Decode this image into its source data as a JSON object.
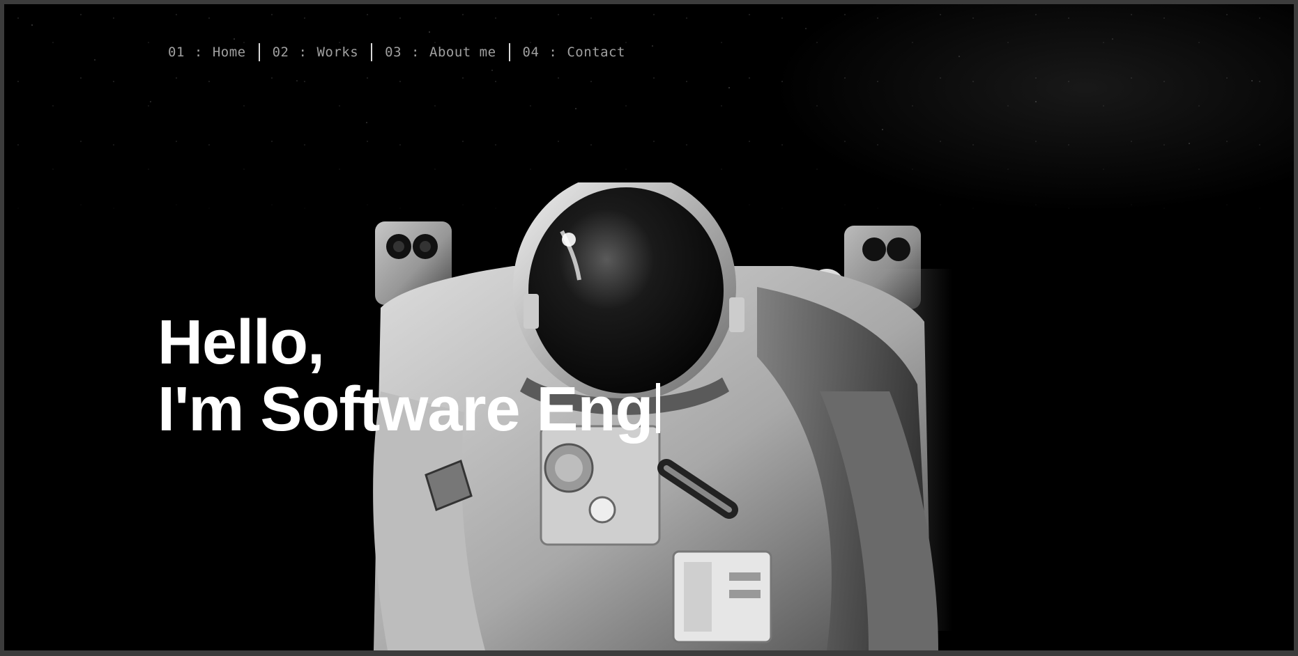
{
  "nav": {
    "items": [
      {
        "number": "01",
        "separator": ":",
        "label": "Home"
      },
      {
        "number": "02",
        "separator": ":",
        "label": "Works"
      },
      {
        "number": "03",
        "separator": ":",
        "label": "About me"
      },
      {
        "number": "04",
        "separator": ":",
        "label": "Contact"
      }
    ]
  },
  "hero": {
    "line1": "Hello,",
    "line2": "I'm Software Eng"
  },
  "background": {
    "image": "astronaut-in-space",
    "color": "#000000"
  },
  "colors": {
    "text": "#ffffff",
    "nav_text": "#a0a0a0",
    "frame": "#3c3c3c"
  }
}
